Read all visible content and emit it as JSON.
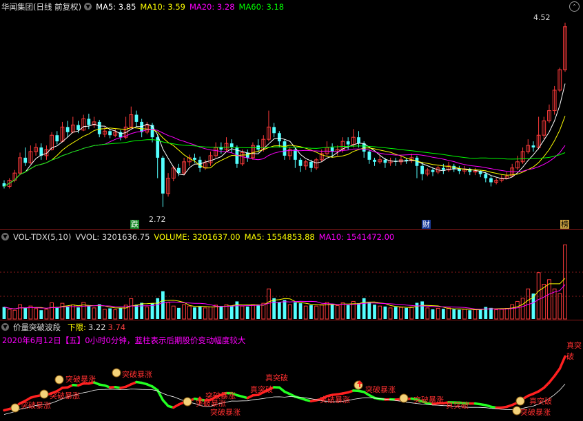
{
  "main_header": {
    "stock_title": "华闻集团(日线 前复权)",
    "ma5": "MA5: 3.85",
    "ma10": "MA10: 3.59",
    "ma20": "MA20: 3.28",
    "ma60": "MA60: 3.18"
  },
  "price_labels": {
    "high": "4.52",
    "low": "2.72"
  },
  "event_tags": [
    "跌",
    "财",
    "榜"
  ],
  "vol_header": {
    "title": "VOL-TDX(5,10)",
    "vvol": "VVOL: 3201636.75",
    "volume": "VOLUME: 3201637.00",
    "ma5": "MA5: 1554853.88",
    "ma10": "MA10: 1541472.00"
  },
  "wave_header": {
    "title": "价量突破波段",
    "lower_limit_label": "下限:",
    "lower_limit_a": "3.22",
    "lower_limit_b": "3.74"
  },
  "wave_note": "2020年6月12日【五】0小时0分钟，蓝柱表示后期股价变动幅度较大",
  "wave_annotations": [
    "突破暴涨",
    "突破暴涨",
    "突破暴涨",
    "突破暴涨",
    "突破暴涨",
    "突破暴涨",
    "突破暴涨",
    "真突破",
    "真突破",
    "突破暴涨",
    "突破暴涨",
    "突破暴涨",
    "突破暴涨",
    "真突破",
    "真突破",
    "真突破"
  ],
  "colors": {
    "up": "#ff3b3b",
    "down": "#54ffff",
    "ma5": "#ffffff",
    "ma10": "#ffff00",
    "ma20": "#ff00ff",
    "ma60": "#00ff00",
    "grid": "#8b1a1a"
  },
  "chart_data": [
    {
      "type": "candlestick",
      "title": "华闻集团(日线 前复权)",
      "ylim": [
        2.6,
        4.62
      ],
      "series": [
        {
          "name": "K",
          "values": [
            [
              2.95,
              2.92,
              2.98,
              2.9
            ],
            [
              2.92,
              2.98,
              3.0,
              2.9
            ],
            [
              2.98,
              3.05,
              3.08,
              2.96
            ],
            [
              3.05,
              3.2,
              3.25,
              3.03
            ],
            [
              3.2,
              3.15,
              3.3,
              3.12
            ],
            [
              3.15,
              3.26,
              3.32,
              3.14
            ],
            [
              3.26,
              3.3,
              3.34,
              3.22
            ],
            [
              3.3,
              3.22,
              3.34,
              3.18
            ],
            [
              3.22,
              3.28,
              3.32,
              3.18
            ],
            [
              3.28,
              3.42,
              3.45,
              3.27
            ],
            [
              3.42,
              3.36,
              3.46,
              3.33
            ],
            [
              3.36,
              3.5,
              3.55,
              3.35
            ],
            [
              3.5,
              3.45,
              3.56,
              3.4
            ],
            [
              3.45,
              3.52,
              3.6,
              3.44
            ],
            [
              3.52,
              3.47,
              3.56,
              3.44
            ],
            [
              3.47,
              3.58,
              3.62,
              3.46
            ],
            [
              3.58,
              3.52,
              3.63,
              3.48
            ],
            [
              3.52,
              3.55,
              3.6,
              3.49
            ],
            [
              3.55,
              3.43,
              3.57,
              3.4
            ],
            [
              3.43,
              3.46,
              3.5,
              3.4
            ],
            [
              3.46,
              3.42,
              3.48,
              3.39
            ],
            [
              3.42,
              3.45,
              3.48,
              3.4
            ],
            [
              3.45,
              3.4,
              3.47,
              3.37
            ],
            [
              3.4,
              3.5,
              3.6,
              3.38
            ],
            [
              3.5,
              3.62,
              3.7,
              3.48
            ],
            [
              3.62,
              3.55,
              3.66,
              3.5
            ],
            [
              3.55,
              3.45,
              3.58,
              3.4
            ],
            [
              3.45,
              3.52,
              3.55,
              3.43
            ],
            [
              3.52,
              3.4,
              3.54,
              3.35
            ],
            [
              3.4,
              3.2,
              3.42,
              3.0
            ],
            [
              3.2,
              2.85,
              3.22,
              2.72
            ],
            [
              2.85,
              3.0,
              3.05,
              2.82
            ],
            [
              3.0,
              3.1,
              3.12,
              2.97
            ],
            [
              3.1,
              3.05,
              3.14,
              3.02
            ],
            [
              3.05,
              3.16,
              3.2,
              3.03
            ],
            [
              3.16,
              3.2,
              3.23,
              3.12
            ],
            [
              3.2,
              3.18,
              3.24,
              3.15
            ],
            [
              3.18,
              3.1,
              3.21,
              3.06
            ],
            [
              3.1,
              3.15,
              3.18,
              3.08
            ],
            [
              3.15,
              3.22,
              3.26,
              3.12
            ],
            [
              3.22,
              3.3,
              3.35,
              3.2
            ],
            [
              3.3,
              3.28,
              3.35,
              3.24
            ],
            [
              3.28,
              3.34,
              3.4,
              3.26
            ],
            [
              3.34,
              3.3,
              3.38,
              3.25
            ],
            [
              3.3,
              3.14,
              3.32,
              3.1
            ],
            [
              3.14,
              3.25,
              3.28,
              3.12
            ],
            [
              3.25,
              3.2,
              3.28,
              3.16
            ],
            [
              3.2,
              3.32,
              3.35,
              3.18
            ],
            [
              3.32,
              3.28,
              3.38,
              3.25
            ],
            [
              3.28,
              3.38,
              3.42,
              3.26
            ],
            [
              3.38,
              3.5,
              3.66,
              3.36
            ],
            [
              3.5,
              3.44,
              3.54,
              3.4
            ],
            [
              3.44,
              3.36,
              3.46,
              3.3
            ],
            [
              3.36,
              3.22,
              3.38,
              3.18
            ],
            [
              3.22,
              3.28,
              3.3,
              3.18
            ],
            [
              3.28,
              3.18,
              3.3,
              3.1
            ],
            [
              3.18,
              3.12,
              3.2,
              3.06
            ],
            [
              3.12,
              3.16,
              3.18,
              3.08
            ],
            [
              3.16,
              3.1,
              3.18,
              3.06
            ],
            [
              3.1,
              3.18,
              3.2,
              3.08
            ],
            [
              3.18,
              3.24,
              3.28,
              3.16
            ],
            [
              3.24,
              3.3,
              3.36,
              3.22
            ],
            [
              3.3,
              3.26,
              3.34,
              3.2
            ],
            [
              3.26,
              3.28,
              3.32,
              3.22
            ],
            [
              3.28,
              3.36,
              3.4,
              3.25
            ],
            [
              3.36,
              3.33,
              3.4,
              3.28
            ],
            [
              3.33,
              3.4,
              3.48,
              3.3
            ],
            [
              3.4,
              3.34,
              3.46,
              3.3
            ],
            [
              3.34,
              3.26,
              3.36,
              3.2
            ],
            [
              3.26,
              3.18,
              3.28,
              3.14
            ],
            [
              3.18,
              3.16,
              3.2,
              3.12
            ],
            [
              3.16,
              3.18,
              3.22,
              3.14
            ],
            [
              3.18,
              3.15,
              3.2,
              3.1
            ],
            [
              3.15,
              3.17,
              3.2,
              3.12
            ],
            [
              3.17,
              3.16,
              3.2,
              3.12
            ],
            [
              3.16,
              3.18,
              3.22,
              3.13
            ],
            [
              3.18,
              3.17,
              3.2,
              3.14
            ],
            [
              3.17,
              3.2,
              3.24,
              3.15
            ],
            [
              3.2,
              3.12,
              3.22,
              3.0
            ],
            [
              3.12,
              3.04,
              3.16,
              2.98
            ],
            [
              3.04,
              3.08,
              3.1,
              3.02
            ],
            [
              3.08,
              3.06,
              3.1,
              3.02
            ],
            [
              3.06,
              3.1,
              3.12,
              3.04
            ],
            [
              3.1,
              3.08,
              3.14,
              3.04
            ],
            [
              3.08,
              3.12,
              3.16,
              3.06
            ],
            [
              3.12,
              3.09,
              3.14,
              3.06
            ],
            [
              3.09,
              3.07,
              3.12,
              3.04
            ],
            [
              3.07,
              3.09,
              3.12,
              3.04
            ],
            [
              3.09,
              3.06,
              3.1,
              3.03
            ],
            [
              3.06,
              3.07,
              3.1,
              3.03
            ],
            [
              3.07,
              3.04,
              3.08,
              3.01
            ],
            [
              3.04,
              3.0,
              3.06,
              2.96
            ],
            [
              3.0,
              2.96,
              3.02,
              2.92
            ],
            [
              2.96,
              2.98,
              3.0,
              2.94
            ],
            [
              2.98,
              3.0,
              3.03,
              2.96
            ],
            [
              3.0,
              3.02,
              3.06,
              2.99
            ],
            [
              3.02,
              3.1,
              3.14,
              3.01
            ],
            [
              3.1,
              3.16,
              3.22,
              3.08
            ],
            [
              3.16,
              3.26,
              3.3,
              3.14
            ],
            [
              3.26,
              3.32,
              3.38,
              3.24
            ],
            [
              3.32,
              3.3,
              3.36,
              3.26
            ],
            [
              3.3,
              3.42,
              3.6,
              3.28
            ],
            [
              3.42,
              3.56,
              3.6,
              3.38
            ],
            [
              3.56,
              3.66,
              3.72,
              3.54
            ],
            [
              3.66,
              3.86,
              3.9,
              3.62
            ],
            [
              3.86,
              4.06,
              4.08,
              3.84
            ],
            [
              4.06,
              4.48,
              4.52,
              4.04
            ]
          ]
        }
      ]
    },
    {
      "type": "bar",
      "title": "VOL-TDX(5,10)",
      "ylim": [
        0,
        3300000
      ],
      "series": [
        {
          "name": "VOLUME",
          "values": [
            520000,
            410000,
            380000,
            620000,
            480000,
            560000,
            450000,
            380000,
            420000,
            700000,
            520000,
            680000,
            540000,
            610000,
            500000,
            720000,
            560000,
            480000,
            640000,
            420000,
            460000,
            400000,
            480000,
            600000,
            880000,
            620000,
            700000,
            520000,
            680000,
            900000,
            1200000,
            720000,
            560000,
            480000,
            620000,
            560000,
            500000,
            540000,
            480000,
            520000,
            600000,
            560000,
            620000,
            580000,
            760000,
            560000,
            540000,
            620000,
            580000,
            680000,
            1300000,
            900000,
            720000,
            820000,
            620000,
            720000,
            680000,
            560000,
            600000,
            560000,
            620000,
            720000,
            640000,
            580000,
            700000,
            600000,
            760000,
            680000,
            900000,
            720000,
            620000,
            560000,
            540000,
            480000,
            520000,
            500000,
            480000,
            520000,
            700000,
            760000,
            480000,
            420000,
            460000,
            440000,
            480000,
            420000,
            400000,
            420000,
            380000,
            400000,
            420000,
            520000,
            480000,
            400000,
            420000,
            460000,
            620000,
            760000,
            900000,
            1300000,
            1100000,
            2000000,
            1500000,
            1700000,
            1300000,
            1100000,
            3201637
          ]
        },
        {
          "name": "MA5",
          "values": []
        },
        {
          "name": "MA10",
          "values": []
        }
      ]
    },
    {
      "type": "line",
      "title": "价量突破波段"
    }
  ]
}
